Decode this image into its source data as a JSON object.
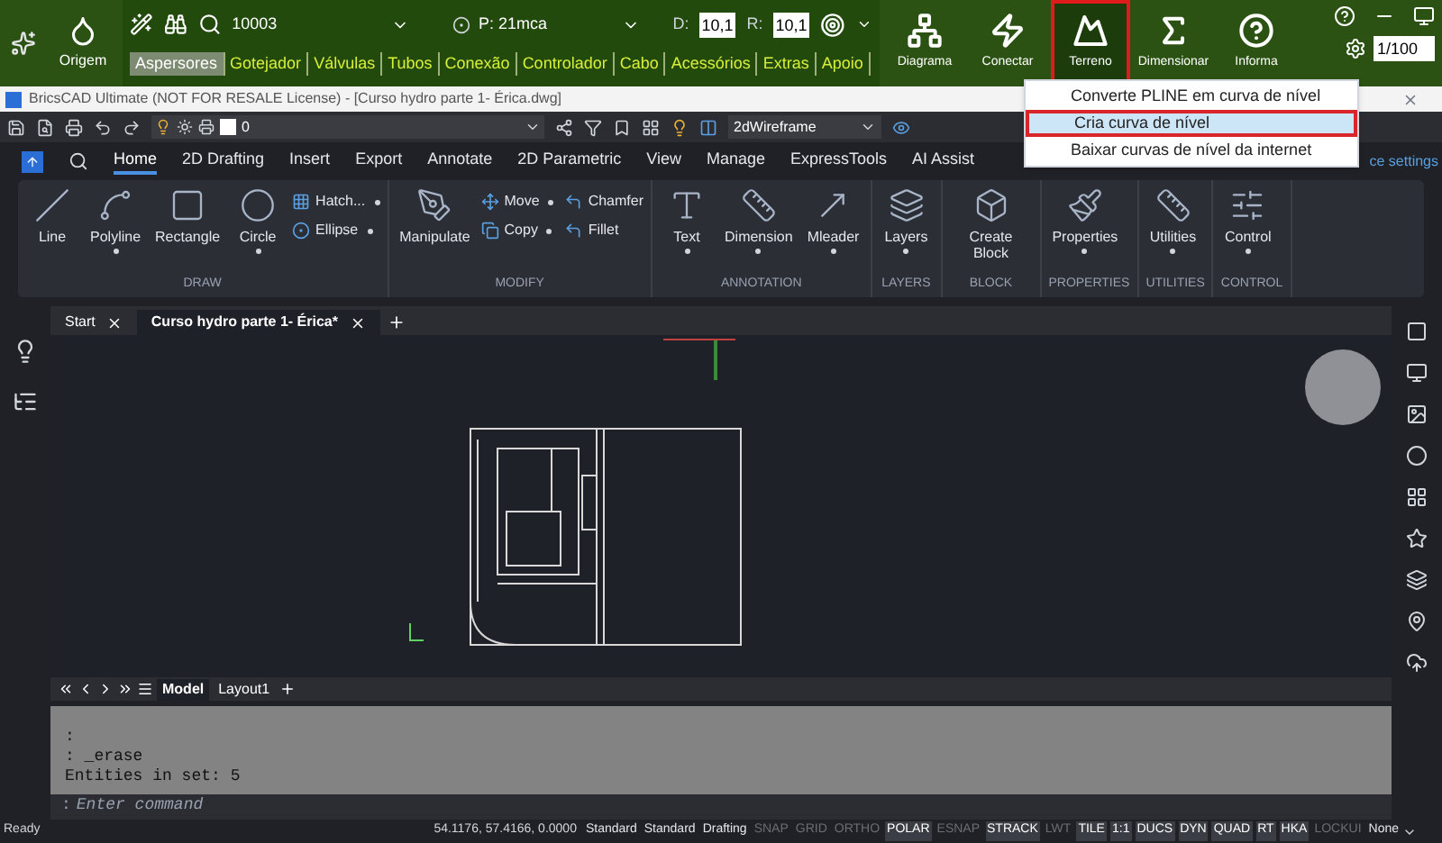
{
  "top_bar": {
    "origin_label": "Origem",
    "pipe_id": "10003",
    "pressure": "P: 21mca",
    "d_label": "D:",
    "d_value": "10,1",
    "r_label": "R:",
    "r_value": "10,1",
    "tabs": [
      {
        "label": "Aspersores",
        "selected": true
      },
      {
        "label": "Gotejador",
        "selected": false
      },
      {
        "label": "Válvulas",
        "selected": false
      },
      {
        "label": "Tubos",
        "selected": false
      },
      {
        "label": "Conexão",
        "selected": false
      },
      {
        "label": "Controlador",
        "selected": false
      },
      {
        "label": "Cabo",
        "selected": false
      },
      {
        "label": "Acessórios",
        "selected": false
      },
      {
        "label": "Extras",
        "selected": false
      },
      {
        "label": "Apoio",
        "selected": false
      }
    ],
    "tools": [
      {
        "label": "Diagrama",
        "selected": false
      },
      {
        "label": "Conectar",
        "selected": false
      },
      {
        "label": "Terreno",
        "selected": true
      },
      {
        "label": "Dimensionar",
        "selected": false
      },
      {
        "label": "Informa",
        "selected": false
      }
    ],
    "scale": "1/100"
  },
  "title_bar": {
    "title": "BricsCAD Ultimate (NOT FOR RESALE License) - [Curso hydro parte 1- Érica.dwg]"
  },
  "dropdown_menu": {
    "items": [
      {
        "label": "Converte PLINE em curva de nível",
        "selected": false
      },
      {
        "label": "Cria curva de nível",
        "selected": true
      },
      {
        "label": "Baixar curvas de nível da internet",
        "selected": false
      }
    ]
  },
  "quick_access": {
    "layer": "0",
    "visual_style": "2dWireframe"
  },
  "ribbon": {
    "tabs": [
      {
        "label": "Home",
        "selected": true
      },
      {
        "label": "2D Drafting",
        "selected": false
      },
      {
        "label": "Insert",
        "selected": false
      },
      {
        "label": "Export",
        "selected": false
      },
      {
        "label": "Annotate",
        "selected": false
      },
      {
        "label": "2D Parametric",
        "selected": false
      },
      {
        "label": "View",
        "selected": false
      },
      {
        "label": "Manage",
        "selected": false
      },
      {
        "label": "ExpressTools",
        "selected": false
      },
      {
        "label": "AI Assist",
        "selected": false
      }
    ],
    "workspace_settings": "ce settings",
    "groups": [
      {
        "title": "DRAW",
        "tools": [
          {
            "label": "Line",
            "kind": "large",
            "dropdown": false
          },
          {
            "label": "Polyline",
            "kind": "large",
            "dropdown": true
          },
          {
            "label": "Rectangle",
            "kind": "large",
            "dropdown": false
          },
          {
            "label": "Circle",
            "kind": "large",
            "dropdown": true
          },
          {
            "label": "Hatch...",
            "kind": "small",
            "dropdown": true
          },
          {
            "label": "Ellipse",
            "kind": "small",
            "dropdown": true
          }
        ]
      },
      {
        "title": "MODIFY",
        "tools": [
          {
            "label": "Manipulate",
            "kind": "large",
            "dropdown": false
          },
          {
            "label": "Move",
            "kind": "small",
            "dropdown": true
          },
          {
            "label": "Copy",
            "kind": "small",
            "dropdown": true
          },
          {
            "label": "Chamfer",
            "kind": "small",
            "dropdown": false
          },
          {
            "label": "Fillet",
            "kind": "small",
            "dropdown": false
          }
        ]
      },
      {
        "title": "ANNOTATION",
        "tools": [
          {
            "label": "Text",
            "kind": "large",
            "dropdown": true
          },
          {
            "label": "Dimension",
            "kind": "large",
            "dropdown": true
          },
          {
            "label": "Mleader",
            "kind": "large",
            "dropdown": true
          }
        ]
      },
      {
        "title": "LAYERS",
        "tools": [
          {
            "label": "Layers",
            "kind": "large",
            "dropdown": true
          }
        ]
      },
      {
        "title": "BLOCK",
        "tools": [
          {
            "label": "Create Block",
            "kind": "large",
            "dropdown": false
          }
        ]
      },
      {
        "title": "PROPERTIES",
        "tools": [
          {
            "label": "Properties",
            "kind": "large",
            "dropdown": true
          }
        ]
      },
      {
        "title": "UTILITIES",
        "tools": [
          {
            "label": "Utilities",
            "kind": "large",
            "dropdown": true
          }
        ]
      },
      {
        "title": "CONTROL",
        "tools": [
          {
            "label": "Control",
            "kind": "large",
            "dropdown": true
          }
        ]
      }
    ]
  },
  "document_tabs": [
    {
      "label": "Start",
      "selected": false
    },
    {
      "label": "Curso hydro parte 1- Érica*",
      "selected": true
    }
  ],
  "layout_tabs": [
    {
      "label": "Model",
      "selected": true
    },
    {
      "label": "Layout1",
      "selected": false
    }
  ],
  "command_history": [
    ":",
    ": _erase",
    "Entities in set: 5"
  ],
  "command_input": {
    "prompt": ":",
    "placeholder": "Enter command"
  },
  "status_bar": {
    "status": "Ready",
    "coordinates": "54.1176, 57.4166, 0.0000",
    "items": [
      {
        "label": "Standard",
        "kind": "text",
        "on": true
      },
      {
        "label": "Standard",
        "kind": "text",
        "on": true
      },
      {
        "label": "Drafting",
        "kind": "text",
        "on": true
      },
      {
        "label": "SNAP",
        "kind": "toggle",
        "on": false
      },
      {
        "label": "GRID",
        "kind": "toggle",
        "on": false
      },
      {
        "label": "ORTHO",
        "kind": "toggle",
        "on": false
      },
      {
        "label": "POLAR",
        "kind": "toggle",
        "on": true
      },
      {
        "label": "ESNAP",
        "kind": "toggle",
        "on": false
      },
      {
        "label": "STRACK",
        "kind": "toggle",
        "on": true
      },
      {
        "label": "LWT",
        "kind": "toggle",
        "on": false
      },
      {
        "label": "TILE",
        "kind": "toggle",
        "on": true
      },
      {
        "label": "1:1",
        "kind": "toggle",
        "on": true
      },
      {
        "label": "DUCS",
        "kind": "toggle",
        "on": true
      },
      {
        "label": "DYN",
        "kind": "toggle",
        "on": true
      },
      {
        "label": "QUAD",
        "kind": "toggle",
        "on": true
      },
      {
        "label": "RT",
        "kind": "toggle",
        "on": true
      },
      {
        "label": "HKA",
        "kind": "toggle",
        "on": true
      },
      {
        "label": "LOCKUI",
        "kind": "toggle",
        "on": false
      },
      {
        "label": "None",
        "kind": "text",
        "on": true
      }
    ]
  }
}
